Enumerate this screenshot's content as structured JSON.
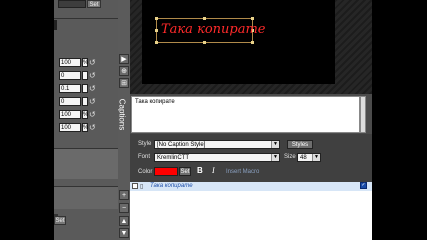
{
  "preview": {
    "caption_text": "Така копирате"
  },
  "left_panel": {
    "top_button": "Set",
    "values": [
      "100",
      "0",
      "0.1",
      "0",
      "100",
      "100"
    ],
    "units": [
      "%",
      "",
      "",
      "",
      "%",
      "%"
    ],
    "lower_set_button": "Set"
  },
  "side_tab": {
    "label": "Captions"
  },
  "editor": {
    "text": "Така копирате"
  },
  "props": {
    "style_label": "Style",
    "style_value": "[No Caption Style]",
    "styles_button": "Styles",
    "font_label": "Font",
    "font_value": "KremlinCTT",
    "size_label": "Size",
    "size_value": "48",
    "color_label": "Color",
    "color_swatch": "#ff0000",
    "set_button": "Set",
    "bold_label": "B",
    "italic_label": "I",
    "insert_macro": "Insert Macro"
  },
  "list": {
    "rows": [
      {
        "text": "Така копирате"
      }
    ]
  },
  "colors": {
    "panel_dark": "#404040",
    "list_highlight": "#d7e6f7",
    "caption_red": "#ff2a2a"
  }
}
